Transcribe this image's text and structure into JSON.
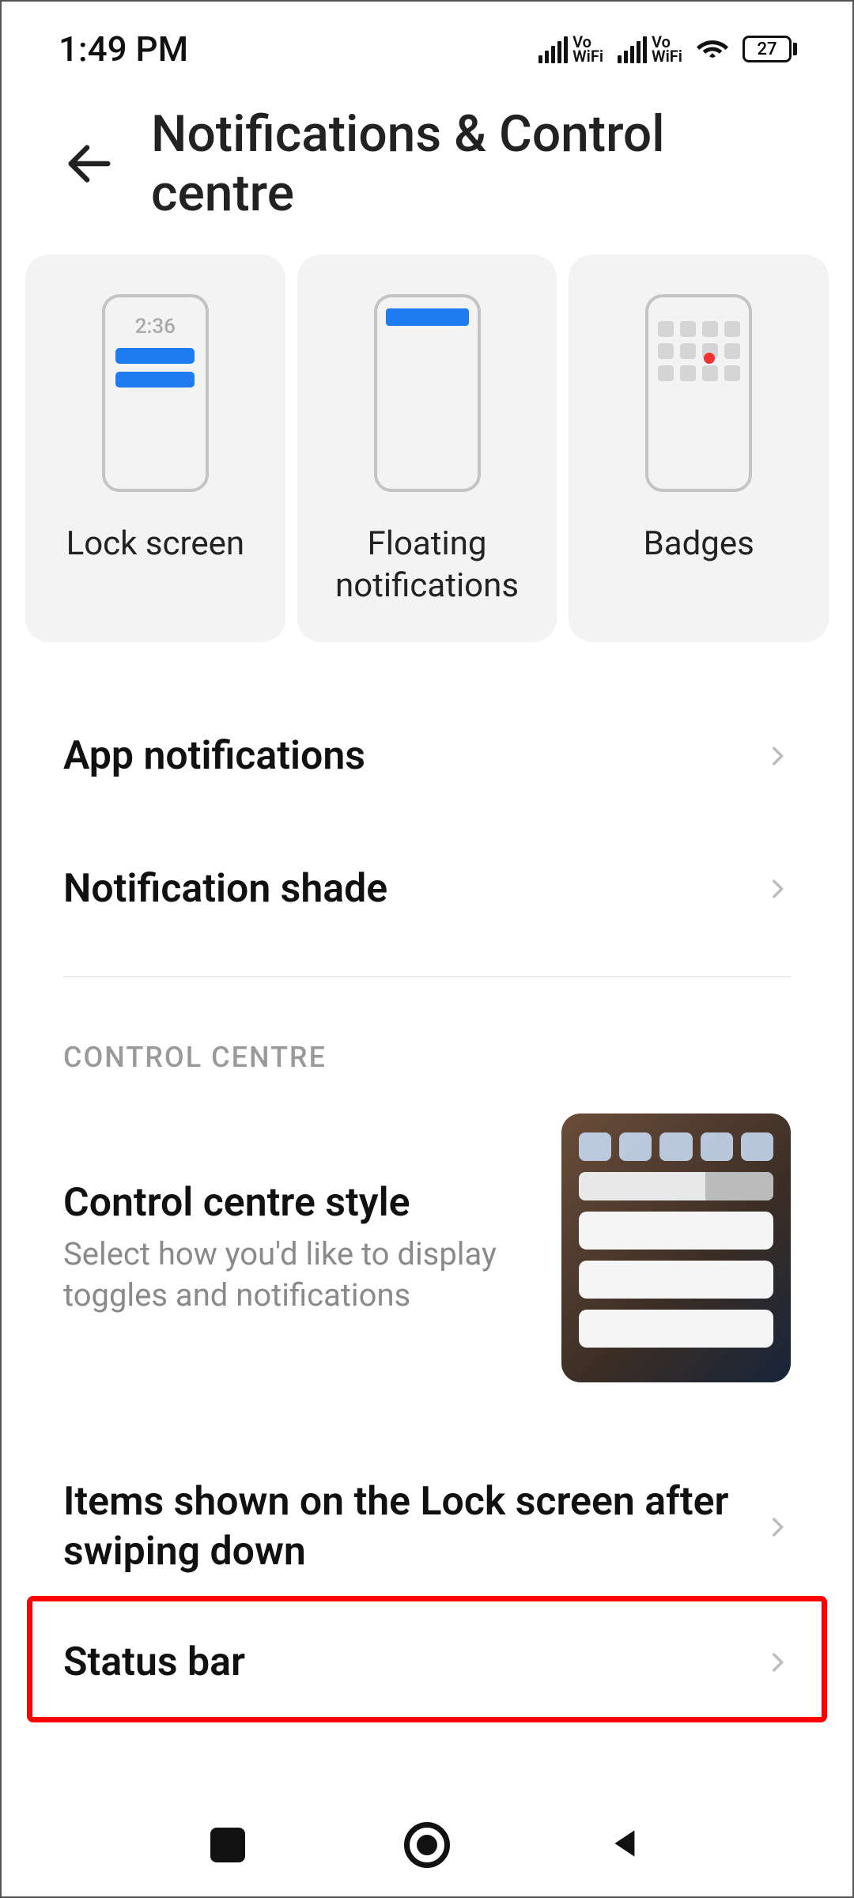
{
  "status": {
    "time": "1:49 PM",
    "vowifi": "Vo\nWiFi",
    "battery_pct": "27"
  },
  "header": {
    "title": "Notifications & Control centre"
  },
  "cards": {
    "lock": {
      "label": "Lock screen",
      "mock_time": "2:36"
    },
    "floating": {
      "label": "Floating notifications"
    },
    "badges": {
      "label": "Badges"
    }
  },
  "rows": {
    "app_notifications": "App notifications",
    "notification_shade": "Notification shade",
    "items_lock": "Items shown on the Lock screen after swiping down",
    "status_bar": "Status bar"
  },
  "section": {
    "control_centre": "CONTROL CENTRE"
  },
  "cc": {
    "title": "Control centre style",
    "subtitle": "Select how you'd like to display toggles and notifications"
  }
}
